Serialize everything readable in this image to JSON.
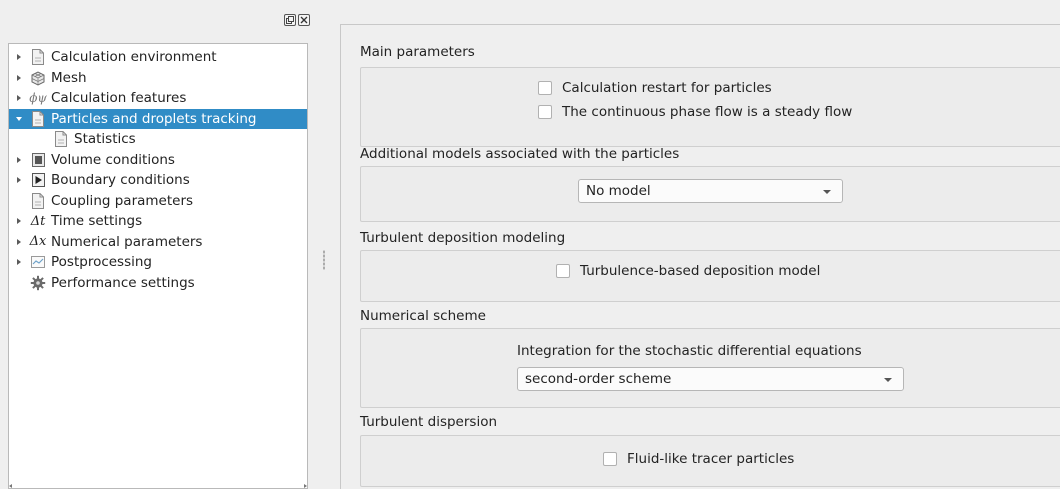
{
  "tree": {
    "items": [
      {
        "label": "Calculation environment",
        "icon": "document-icon",
        "expander": "collapsed",
        "indent": 0
      },
      {
        "label": "Mesh",
        "icon": "mesh-icon",
        "expander": "collapsed",
        "indent": 0
      },
      {
        "label": "Calculation features",
        "icon": "phi-symbol-icon",
        "symbol": "ϕψ",
        "expander": "collapsed",
        "indent": 0
      },
      {
        "label": "Particles and droplets tracking",
        "icon": "document-icon",
        "expander": "expanded",
        "indent": 0,
        "selected": true
      },
      {
        "label": "Statistics",
        "icon": "document-icon",
        "expander": "none",
        "indent": 1
      },
      {
        "label": "Volume conditions",
        "icon": "volume-icon",
        "expander": "collapsed",
        "indent": 0
      },
      {
        "label": "Boundary conditions",
        "icon": "boundary-icon",
        "expander": "collapsed",
        "indent": 0
      },
      {
        "label": "Coupling parameters",
        "icon": "document-icon",
        "expander": "none",
        "indent": 0
      },
      {
        "label": "Time settings",
        "icon": "delta-t-icon",
        "symbol": "Δt",
        "expander": "collapsed",
        "indent": 0
      },
      {
        "label": "Numerical parameters",
        "icon": "delta-x-icon",
        "symbol": "Δx",
        "expander": "collapsed",
        "indent": 0
      },
      {
        "label": "Postprocessing",
        "icon": "chart-icon",
        "expander": "collapsed",
        "indent": 0
      },
      {
        "label": "Performance settings",
        "icon": "gear-icon",
        "expander": "none",
        "indent": 0
      }
    ]
  },
  "main": {
    "main_parameters": {
      "title": "Main parameters",
      "restart_label": "Calculation restart for particles",
      "restart_checked": false,
      "steady_label": "The continuous phase flow is a steady flow",
      "steady_checked": false
    },
    "additional_models": {
      "title": "Additional models associated with the particles",
      "model_value": "No model"
    },
    "turbulent_deposition": {
      "title": "Turbulent deposition modeling",
      "deposition_label": "Turbulence-based deposition model",
      "deposition_checked": false
    },
    "numerical_scheme": {
      "title": "Numerical scheme",
      "integration_label": "Integration for the stochastic differential equations",
      "scheme_value": "second-order scheme"
    },
    "turbulent_dispersion": {
      "title": "Turbulent dispersion",
      "tracer_label": "Fluid-like tracer particles",
      "tracer_checked": false
    }
  }
}
